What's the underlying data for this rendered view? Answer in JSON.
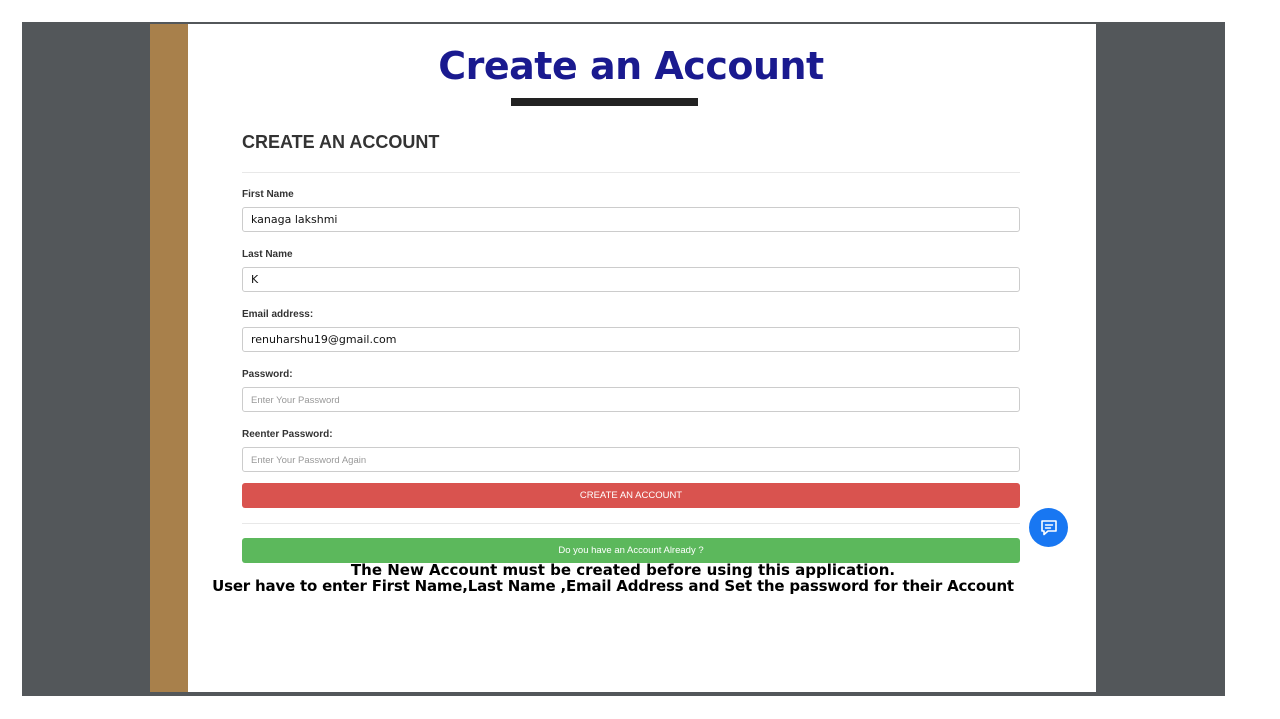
{
  "slide": {
    "title": "Create an Account",
    "caption_line1": "The New Account must be created before using this application.",
    "caption_line2": "User have to enter First Name,Last Name ,Email Address and Set the password for their Account"
  },
  "form": {
    "heading": "CREATE AN ACCOUNT",
    "first_name": {
      "label": "First Name",
      "value": "kanaga lakshmi",
      "placeholder": ""
    },
    "last_name": {
      "label": "Last Name",
      "value": "K",
      "placeholder": ""
    },
    "email": {
      "label": "Email address:",
      "value": "renuharshu19@gmail.com",
      "placeholder": ""
    },
    "password": {
      "label": "Password:",
      "value": "",
      "placeholder": "Enter Your Password"
    },
    "reenter_password": {
      "label": "Reenter Password:",
      "value": "",
      "placeholder": "Enter Your Password Again"
    },
    "create_button": "CREATE AN ACCOUNT",
    "login_button": "Do you have an Account Already ?"
  },
  "icons": {
    "chat": "chat-bubble-icon"
  },
  "colors": {
    "title": "#1a1a8f",
    "create_button": "#d9534f",
    "login_button": "#5cb85c",
    "chat_fab": "#1877f2",
    "side_bar": "#a8804b",
    "backdrop": "#53575a"
  }
}
